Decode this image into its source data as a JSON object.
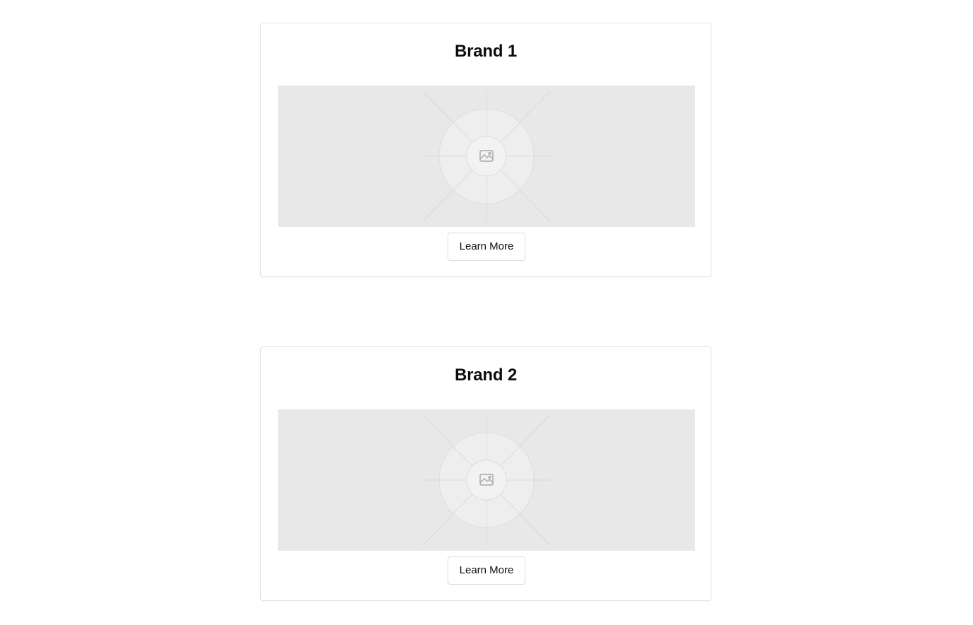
{
  "cards": [
    {
      "title": "Brand 1",
      "image_icon": "image-icon",
      "button_label": "Learn More"
    },
    {
      "title": "Brand 2",
      "image_icon": "image-icon",
      "button_label": "Learn More"
    }
  ],
  "colors": {
    "page_background": "#ffffff",
    "card_border": "#e3e3e3",
    "placeholder_background": "#e8e8e8",
    "placeholder_lines": "#d6d6d6",
    "button_border": "#dcdcdc",
    "title_text": "#0d0d0d"
  }
}
